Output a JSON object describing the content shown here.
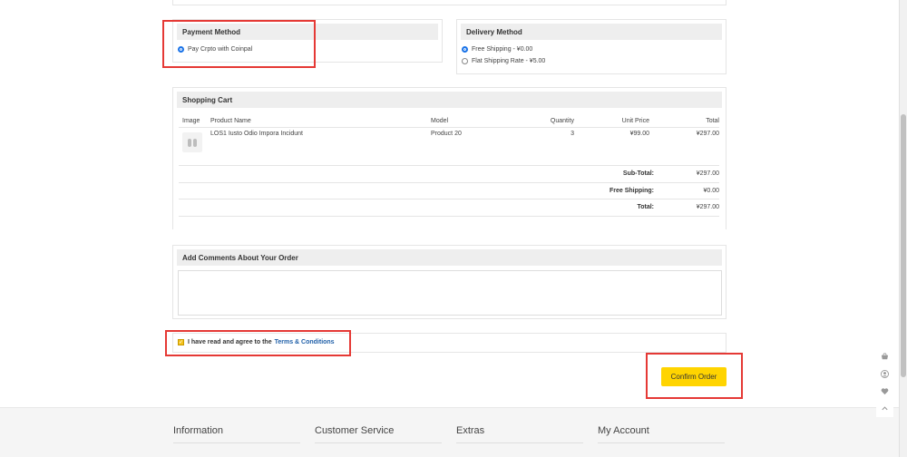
{
  "payment_method": {
    "title": "Payment Method",
    "options": [
      {
        "label": "Pay Crpto with Coinpal",
        "selected": true
      }
    ]
  },
  "delivery_method": {
    "title": "Delivery Method",
    "options": [
      {
        "label": "Free Shipping - ¥0.00",
        "selected": true
      },
      {
        "label": "Flat Shipping Rate - ¥5.00",
        "selected": false
      }
    ]
  },
  "cart": {
    "title": "Shopping Cart",
    "columns": [
      "Image",
      "Product Name",
      "Model",
      "Quantity",
      "Unit Price",
      "Total"
    ],
    "items": [
      {
        "name": "LOS1 Iusto Odio Impora Incidunt",
        "model": "Product 20",
        "quantity": "3",
        "unit_price": "¥99.00",
        "total": "¥297.00"
      }
    ],
    "totals": [
      {
        "label": "Sub-Total:",
        "value": "¥297.00"
      },
      {
        "label": "Free Shipping:",
        "value": "¥0.00"
      },
      {
        "label": "Total:",
        "value": "¥297.00"
      }
    ]
  },
  "comments": {
    "title": "Add Comments About Your Order",
    "value": ""
  },
  "agree": {
    "text": "I have read and agree to the",
    "link": "Terms & Conditions",
    "checked": true
  },
  "confirm_label": "Confirm Order",
  "footer": {
    "columns": [
      "Information",
      "Customer Service",
      "Extras",
      "My Account"
    ]
  },
  "colors": {
    "accent": "#ffd400",
    "highlight": "#e53935",
    "link": "#1f5fa8"
  }
}
